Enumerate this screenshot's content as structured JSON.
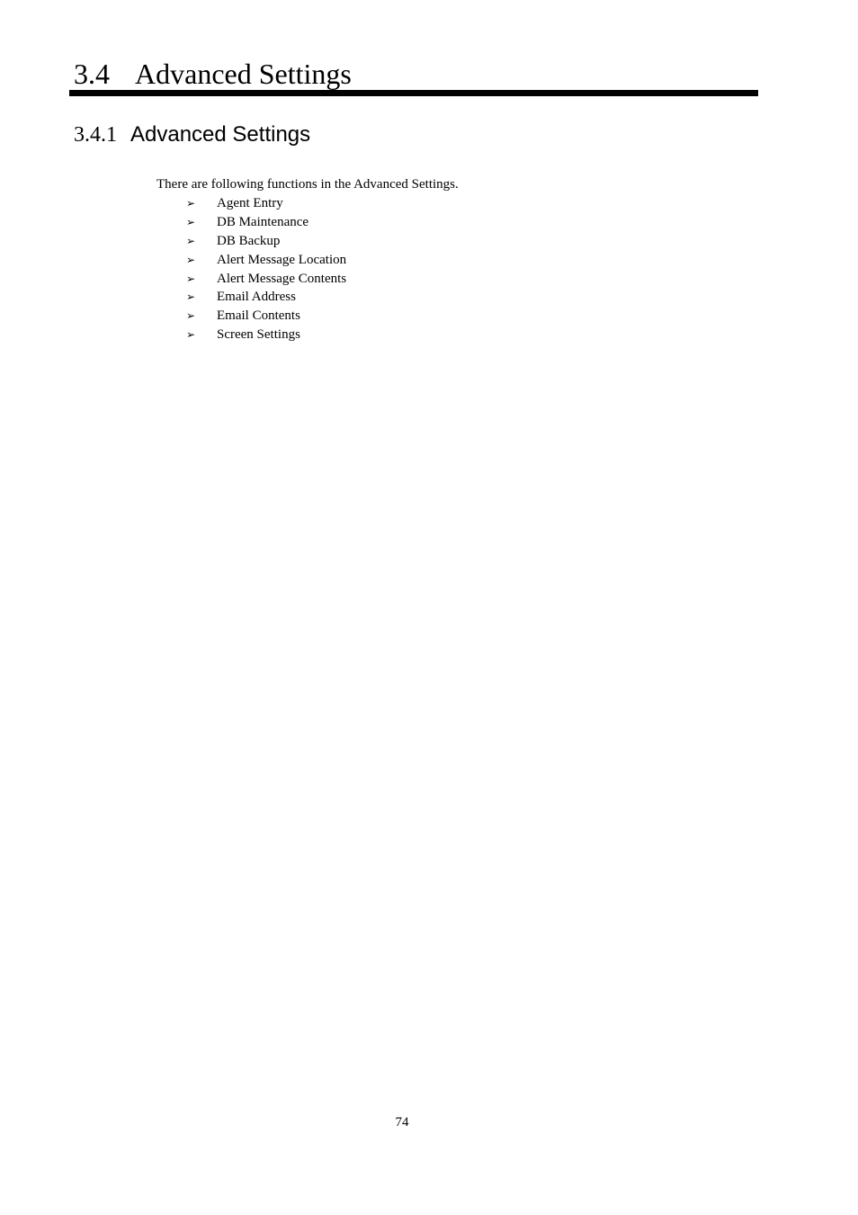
{
  "heading1": {
    "number": "3.4",
    "title": "Advanced Settings"
  },
  "heading2": {
    "number": "3.4.1",
    "title": "Advanced Settings"
  },
  "intro_text": "There are following functions in the Advanced Settings.",
  "bullet_icon": "arrowhead-bullet-icon",
  "bullet_glyph": "➢",
  "functions": [
    {
      "label": "Agent Entry"
    },
    {
      "label": "DB Maintenance"
    },
    {
      "label": "DB Backup"
    },
    {
      "label": "Alert Message Location"
    },
    {
      "label": "Alert Message Contents"
    },
    {
      "label": "Email Address"
    },
    {
      "label": "Email Contents"
    },
    {
      "label": "Screen Settings"
    }
  ],
  "page_number": "74"
}
